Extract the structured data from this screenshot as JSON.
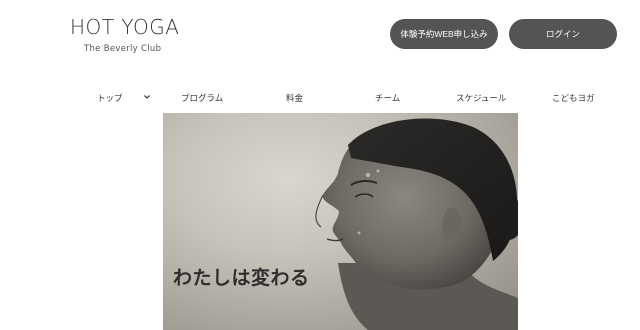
{
  "header": {
    "logo_title": "HOT YOGA",
    "logo_subtitle": "The Beverly Club",
    "trial_button": "体験予約WEB申し込み",
    "login_button": "ログイン"
  },
  "nav": {
    "items": [
      "トップ",
      "プログラム",
      "料金",
      "チーム",
      "スケジュール",
      "こどもヨガ"
    ],
    "dropdown_icon": "chevron-down-icon"
  },
  "hero": {
    "caption": "わたしは変わる"
  },
  "colors": {
    "button_bg": "#555454",
    "button_text": "#ffffff",
    "text": "#333333"
  }
}
